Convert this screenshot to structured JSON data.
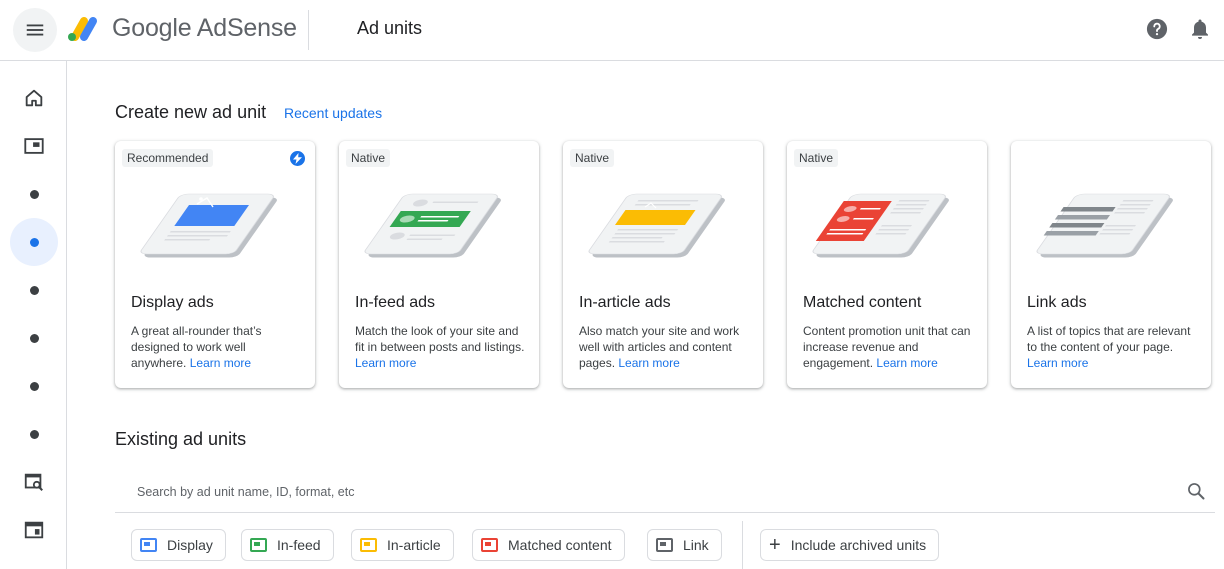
{
  "header": {
    "brand": "Google AdSense",
    "page_title": "Ad units"
  },
  "create": {
    "title": "Create new ad unit",
    "recent_link": "Recent updates"
  },
  "cards": [
    {
      "tag": "Recommended",
      "title": "Display ads",
      "desc": "A great all-rounder that’s designed to work well anywhere.",
      "more": "Learn more",
      "color": "#4285f4"
    },
    {
      "tag": "Native",
      "title": "In-feed ads",
      "desc": "Match the look of your site and fit in between posts and listings.",
      "more": "Learn more",
      "color": "#34a853"
    },
    {
      "tag": "Native",
      "title": "In-article ads",
      "desc": "Also match your site and work well with articles and content pages.",
      "more": "Learn more",
      "color": "#fbbc04"
    },
    {
      "tag": "Native",
      "title": "Matched content",
      "desc": "Content promotion unit that can increase revenue and engagement.",
      "more": "Learn more",
      "color": "#ea4335"
    },
    {
      "tag": "",
      "title": "Link ads",
      "desc": "A list of topics that are relevant to the content of your page.",
      "more": "Learn more",
      "color": "#80868b"
    }
  ],
  "existing": {
    "title": "Existing ad units",
    "search_placeholder": "Search by ad unit name, ID, format, etc"
  },
  "filters": [
    {
      "label": "Display",
      "color": "#4285f4"
    },
    {
      "label": "In-feed",
      "color": "#34a853"
    },
    {
      "label": "In-article",
      "color": "#fbbc04"
    },
    {
      "label": "Matched content",
      "color": "#ea4335"
    },
    {
      "label": "Link",
      "color": "#5f6368"
    }
  ],
  "archived": {
    "label": "Include archived units"
  },
  "sidebar": {
    "active_index": 3
  },
  "colors": {
    "accent": "#1a73e8",
    "border": "#dadce0"
  }
}
